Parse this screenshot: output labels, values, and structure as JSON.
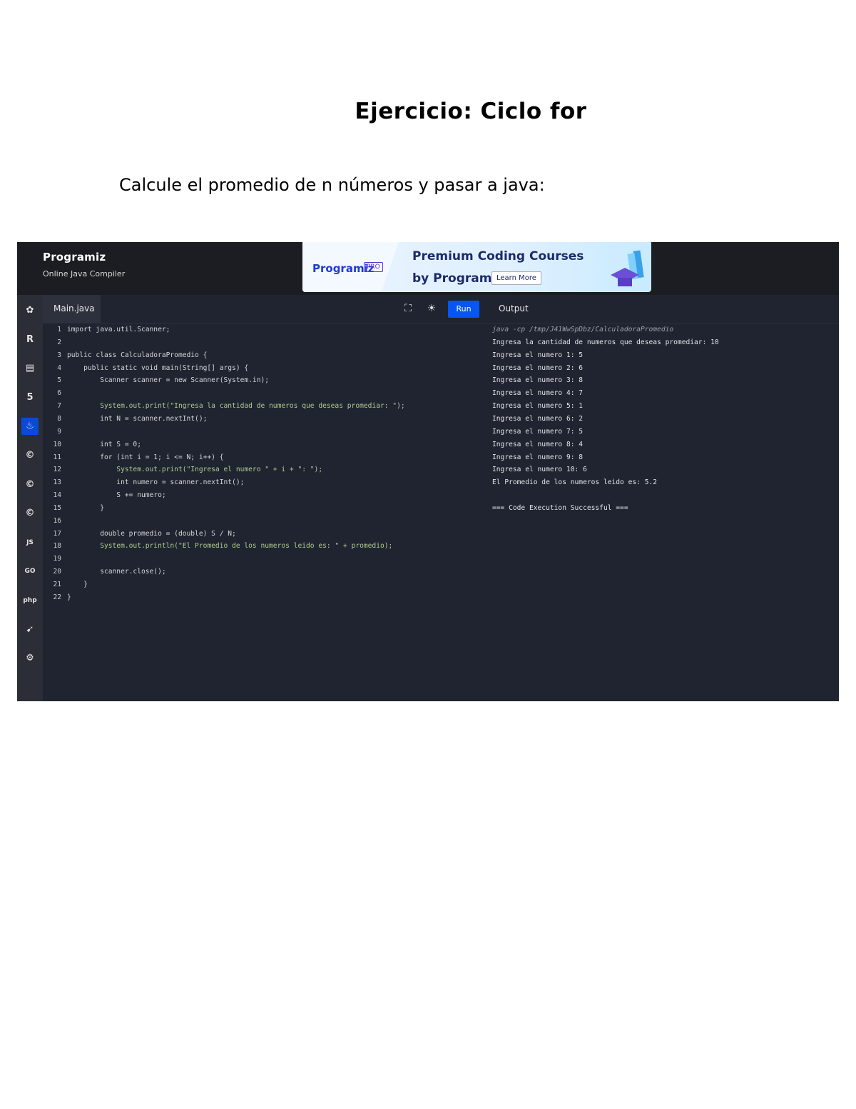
{
  "document": {
    "title": "Ejercicio: Ciclo for",
    "subtitle": "Calcule el promedio de n números y pasar a java:"
  },
  "screenshot": {
    "logo": {
      "name": "Programiz",
      "subtitle": "Online Java Compiler"
    },
    "banner": {
      "brand": "Programiz",
      "badge": "PRO",
      "line1": "Premium Coding Courses",
      "line2": "by Programiz",
      "button": "Learn More"
    },
    "sidebar_icons": [
      "python-icon",
      "r-icon",
      "sql-icon",
      "html-icon",
      "java-icon",
      "c-icon",
      "cpp-icon",
      "csharp-icon",
      "javascript-icon",
      "go-icon",
      "php-icon",
      "swift-icon",
      "rust-icon"
    ],
    "sidebar_labels": [
      "",
      "R",
      "",
      "5",
      "",
      "C",
      "C",
      "C",
      "JS",
      "GO",
      "php",
      "",
      ""
    ],
    "editor": {
      "tab": "Main.java",
      "run_label": "Run",
      "output_label": "Output",
      "fullscreen_icon": "fullscreen-icon",
      "theme_icon": "theme-icon"
    },
    "code_lines": [
      {
        "n": "1",
        "t": "import java.util.Scanner;"
      },
      {
        "n": "2",
        "t": ""
      },
      {
        "n": "3",
        "t": "public class CalculadoraPromedio {"
      },
      {
        "n": "4",
        "t": "    public static void main(String[] args) {"
      },
      {
        "n": "5",
        "t": "        Scanner scanner = new Scanner(System.in);"
      },
      {
        "n": "6",
        "t": ""
      },
      {
        "n": "7",
        "t": "        System.out.print(\"Ingresa la cantidad de numeros que deseas promediar: \");"
      },
      {
        "n": "8",
        "t": "        int N = scanner.nextInt();"
      },
      {
        "n": "9",
        "t": ""
      },
      {
        "n": "10",
        "t": "        int S = 0;"
      },
      {
        "n": "11",
        "t": "        for (int i = 1; i <= N; i++) {"
      },
      {
        "n": "12",
        "t": "            System.out.print(\"Ingresa el numero \" + i + \": \");"
      },
      {
        "n": "13",
        "t": "            int numero = scanner.nextInt();"
      },
      {
        "n": "14",
        "t": "            S += numero;"
      },
      {
        "n": "15",
        "t": "        }"
      },
      {
        "n": "16",
        "t": ""
      },
      {
        "n": "17",
        "t": "        double promedio = (double) S / N;"
      },
      {
        "n": "18",
        "t": "        System.out.println(\"El Promedio de los numeros leido es: \" + promedio);"
      },
      {
        "n": "19",
        "t": ""
      },
      {
        "n": "20",
        "t": "        scanner.close();"
      },
      {
        "n": "21",
        "t": "    }"
      },
      {
        "n": "22",
        "t": "}"
      }
    ],
    "output_lines": [
      "java -cp /tmp/J41WwSpDbz/CalculadoraPromedio",
      "Ingresa la cantidad de numeros que deseas promediar: 10",
      "Ingresa el numero 1: 5",
      "Ingresa el numero 2: 6",
      "Ingresa el numero 3: 8",
      "Ingresa el numero 4: 7",
      "Ingresa el numero 5: 1",
      "Ingresa el numero 6: 2",
      "Ingresa el numero 7: 5",
      "Ingresa el numero 8: 4",
      "Ingresa el numero 9: 8",
      "Ingresa el numero 10: 6",
      "El Promedio de los numeros leido es: 5.2",
      "",
      "=== Code Execution Successful ==="
    ],
    "colors": {
      "editor_bg": "#1f2430",
      "topbar_bg": "#1b1d22",
      "sidebar_bg": "#2b2e36",
      "run_button": "#0556f3",
      "keyword": "#c678dd",
      "string": "#98c379"
    }
  }
}
